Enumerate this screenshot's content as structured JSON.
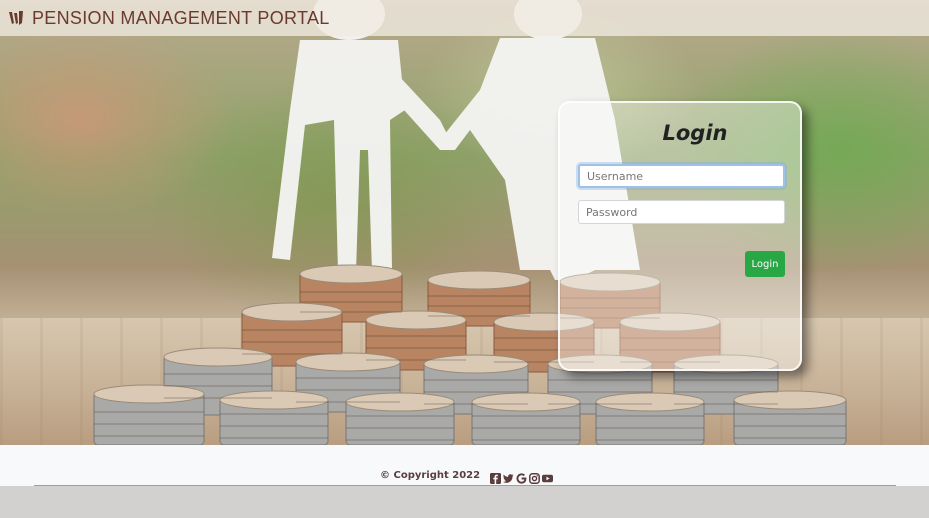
{
  "header": {
    "brand": "PENSION MANAGEMENT PORTAL",
    "logo_icon": "w-logo-icon"
  },
  "login": {
    "title": "Login",
    "username_placeholder": "Username",
    "password_placeholder": "Password",
    "submit_label": "Login"
  },
  "footer": {
    "copyright": "© Copyright 2022",
    "social_icons": [
      "facebook-icon",
      "twitter-icon",
      "google-icon",
      "instagram-icon",
      "youtube-icon"
    ]
  },
  "colors": {
    "brand_text": "#6b3a2e",
    "login_button": "#28a745",
    "footer_line": "#6cc07a"
  }
}
